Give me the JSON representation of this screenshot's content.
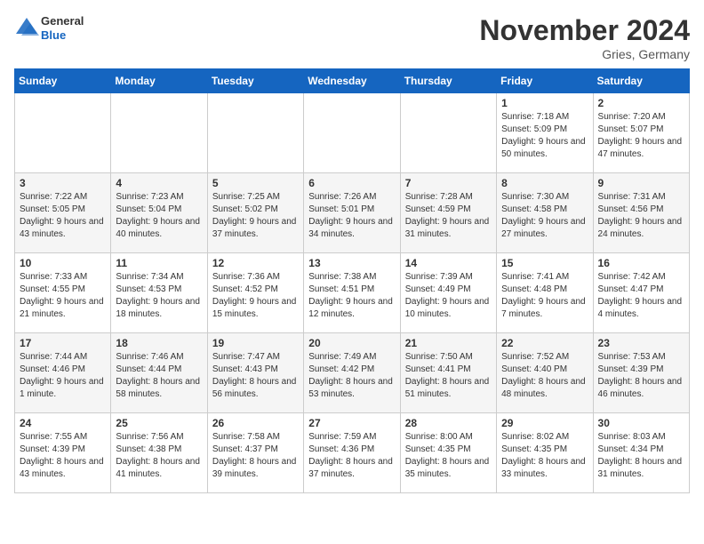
{
  "logo": {
    "general": "General",
    "blue": "Blue"
  },
  "header": {
    "month": "November 2024",
    "location": "Gries, Germany"
  },
  "weekdays": [
    "Sunday",
    "Monday",
    "Tuesday",
    "Wednesday",
    "Thursday",
    "Friday",
    "Saturday"
  ],
  "weeks": [
    [
      {
        "day": "",
        "info": ""
      },
      {
        "day": "",
        "info": ""
      },
      {
        "day": "",
        "info": ""
      },
      {
        "day": "",
        "info": ""
      },
      {
        "day": "",
        "info": ""
      },
      {
        "day": "1",
        "info": "Sunrise: 7:18 AM\nSunset: 5:09 PM\nDaylight: 9 hours\nand 50 minutes."
      },
      {
        "day": "2",
        "info": "Sunrise: 7:20 AM\nSunset: 5:07 PM\nDaylight: 9 hours\nand 47 minutes."
      }
    ],
    [
      {
        "day": "3",
        "info": "Sunrise: 7:22 AM\nSunset: 5:05 PM\nDaylight: 9 hours\nand 43 minutes."
      },
      {
        "day": "4",
        "info": "Sunrise: 7:23 AM\nSunset: 5:04 PM\nDaylight: 9 hours\nand 40 minutes."
      },
      {
        "day": "5",
        "info": "Sunrise: 7:25 AM\nSunset: 5:02 PM\nDaylight: 9 hours\nand 37 minutes."
      },
      {
        "day": "6",
        "info": "Sunrise: 7:26 AM\nSunset: 5:01 PM\nDaylight: 9 hours\nand 34 minutes."
      },
      {
        "day": "7",
        "info": "Sunrise: 7:28 AM\nSunset: 4:59 PM\nDaylight: 9 hours\nand 31 minutes."
      },
      {
        "day": "8",
        "info": "Sunrise: 7:30 AM\nSunset: 4:58 PM\nDaylight: 9 hours\nand 27 minutes."
      },
      {
        "day": "9",
        "info": "Sunrise: 7:31 AM\nSunset: 4:56 PM\nDaylight: 9 hours\nand 24 minutes."
      }
    ],
    [
      {
        "day": "10",
        "info": "Sunrise: 7:33 AM\nSunset: 4:55 PM\nDaylight: 9 hours\nand 21 minutes."
      },
      {
        "day": "11",
        "info": "Sunrise: 7:34 AM\nSunset: 4:53 PM\nDaylight: 9 hours\nand 18 minutes."
      },
      {
        "day": "12",
        "info": "Sunrise: 7:36 AM\nSunset: 4:52 PM\nDaylight: 9 hours\nand 15 minutes."
      },
      {
        "day": "13",
        "info": "Sunrise: 7:38 AM\nSunset: 4:51 PM\nDaylight: 9 hours\nand 12 minutes."
      },
      {
        "day": "14",
        "info": "Sunrise: 7:39 AM\nSunset: 4:49 PM\nDaylight: 9 hours\nand 10 minutes."
      },
      {
        "day": "15",
        "info": "Sunrise: 7:41 AM\nSunset: 4:48 PM\nDaylight: 9 hours\nand 7 minutes."
      },
      {
        "day": "16",
        "info": "Sunrise: 7:42 AM\nSunset: 4:47 PM\nDaylight: 9 hours\nand 4 minutes."
      }
    ],
    [
      {
        "day": "17",
        "info": "Sunrise: 7:44 AM\nSunset: 4:46 PM\nDaylight: 9 hours\nand 1 minute."
      },
      {
        "day": "18",
        "info": "Sunrise: 7:46 AM\nSunset: 4:44 PM\nDaylight: 8 hours\nand 58 minutes."
      },
      {
        "day": "19",
        "info": "Sunrise: 7:47 AM\nSunset: 4:43 PM\nDaylight: 8 hours\nand 56 minutes."
      },
      {
        "day": "20",
        "info": "Sunrise: 7:49 AM\nSunset: 4:42 PM\nDaylight: 8 hours\nand 53 minutes."
      },
      {
        "day": "21",
        "info": "Sunrise: 7:50 AM\nSunset: 4:41 PM\nDaylight: 8 hours\nand 51 minutes."
      },
      {
        "day": "22",
        "info": "Sunrise: 7:52 AM\nSunset: 4:40 PM\nDaylight: 8 hours\nand 48 minutes."
      },
      {
        "day": "23",
        "info": "Sunrise: 7:53 AM\nSunset: 4:39 PM\nDaylight: 8 hours\nand 46 minutes."
      }
    ],
    [
      {
        "day": "24",
        "info": "Sunrise: 7:55 AM\nSunset: 4:39 PM\nDaylight: 8 hours\nand 43 minutes."
      },
      {
        "day": "25",
        "info": "Sunrise: 7:56 AM\nSunset: 4:38 PM\nDaylight: 8 hours\nand 41 minutes."
      },
      {
        "day": "26",
        "info": "Sunrise: 7:58 AM\nSunset: 4:37 PM\nDaylight: 8 hours\nand 39 minutes."
      },
      {
        "day": "27",
        "info": "Sunrise: 7:59 AM\nSunset: 4:36 PM\nDaylight: 8 hours\nand 37 minutes."
      },
      {
        "day": "28",
        "info": "Sunrise: 8:00 AM\nSunset: 4:35 PM\nDaylight: 8 hours\nand 35 minutes."
      },
      {
        "day": "29",
        "info": "Sunrise: 8:02 AM\nSunset: 4:35 PM\nDaylight: 8 hours\nand 33 minutes."
      },
      {
        "day": "30",
        "info": "Sunrise: 8:03 AM\nSunset: 4:34 PM\nDaylight: 8 hours\nand 31 minutes."
      }
    ]
  ]
}
